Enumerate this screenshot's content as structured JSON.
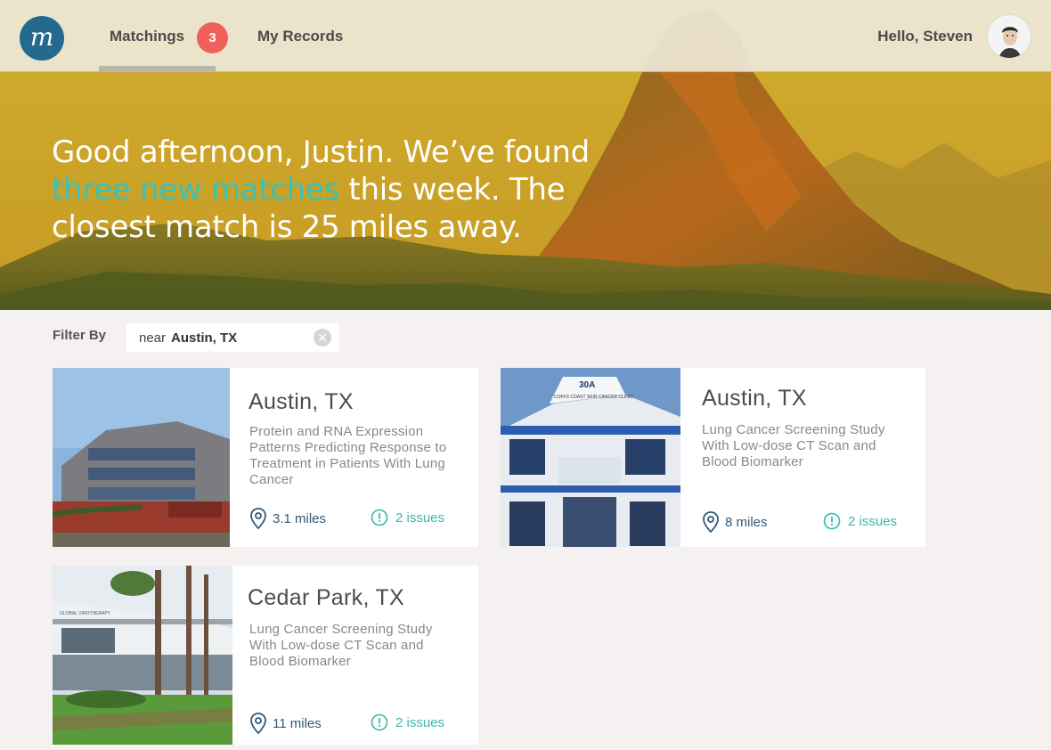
{
  "app": {
    "logo_letter": "m"
  },
  "nav": {
    "tabs": [
      {
        "label": "Matchings",
        "badge": "3",
        "active": true
      },
      {
        "label": "My Records"
      }
    ],
    "greeting": "Hello, Steven"
  },
  "hero": {
    "line_pre": "Good afternoon, Justin. We’ve found",
    "highlight": "three new matches",
    "line_post": "this week. The closest match is 25 miles away."
  },
  "filter": {
    "label": "Filter By",
    "prefix": "near",
    "value": "Austin, TX"
  },
  "cards": [
    {
      "city": "Austin, TX",
      "study": "Protein and RNA Expression Patterns Predicting Response to Treatment in Patients With Lung Cancer",
      "distance": "3.1 miles",
      "issues": "2 issues"
    },
    {
      "city": "Austin, TX",
      "study": "Lung Cancer Screening Study With Low-dose CT Scan and Blood Biomarker",
      "distance": "8 miles",
      "issues": "2 issues",
      "photo_sign": "30A",
      "photo_text": "COFFS COAST SKIN CANCER CLINIC"
    },
    {
      "city": "Cedar Park, TX",
      "study": "Lung Cancer Screening Study With Low-dose CT Scan and Blood Biomarker",
      "distance": "11 miles",
      "issues": "2 issues",
      "photo_text": "GLOBAL VIROTHERAPY"
    }
  ],
  "colors": {
    "brand": "#236a8e",
    "badge": "#f0605a",
    "highlight": "#3bc2b6",
    "distance": "#2c5a78",
    "issues": "#39b9a6"
  },
  "icons": [
    "location-pin-icon",
    "alert-circle-icon",
    "clear-icon"
  ]
}
